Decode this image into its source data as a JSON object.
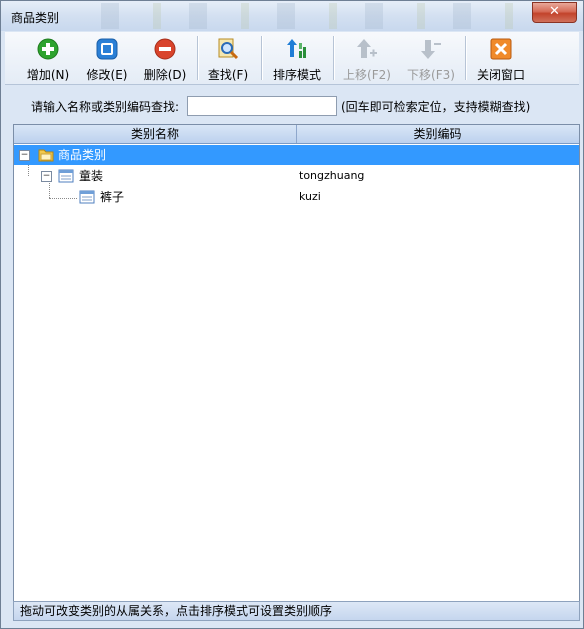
{
  "window": {
    "title": "商品类别",
    "close_glyph": "✕"
  },
  "toolbar": {
    "buttons": [
      {
        "label": "增加(N)",
        "icon": "add-icon",
        "color": "#2ea32e",
        "enabled": true
      },
      {
        "label": "修改(E)",
        "icon": "edit-icon",
        "color": "#2a7fd6",
        "enabled": true
      },
      {
        "label": "删除(D)",
        "icon": "delete-icon",
        "color": "#d9442c",
        "enabled": true
      },
      {
        "label": "查找(F)",
        "icon": "search-icon",
        "color": "#e0a020",
        "enabled": true
      },
      {
        "label": "排序模式",
        "icon": "sort-icon",
        "color": "#2a8f3a",
        "enabled": true
      },
      {
        "label": "上移(F2)",
        "icon": "move-up-icon",
        "color": "#aab2bc",
        "enabled": false
      },
      {
        "label": "下移(F3)",
        "icon": "move-down-icon",
        "color": "#aab2bc",
        "enabled": false
      },
      {
        "label": "关闭窗口",
        "icon": "close-window-icon",
        "color": "#e8731f",
        "enabled": true
      }
    ]
  },
  "search": {
    "label": "请输入名称或类别编码查找:",
    "value": "",
    "hint": "(回车即可检索定位，支持模糊查找)"
  },
  "grid": {
    "columns": [
      "类别名称",
      "类别编码"
    ],
    "rows": [
      {
        "name": "商品类别",
        "code": "",
        "level": 0,
        "selected": true,
        "icon": "folder-icon"
      },
      {
        "name": "童装",
        "code": "tongzhuang",
        "level": 1,
        "selected": false,
        "icon": "category-icon"
      },
      {
        "name": "裤子",
        "code": "kuzi",
        "level": 2,
        "selected": false,
        "icon": "category-icon"
      }
    ]
  },
  "status": {
    "text": "拖动可改变类别的从属关系，点击排序模式可设置类别顺序"
  }
}
